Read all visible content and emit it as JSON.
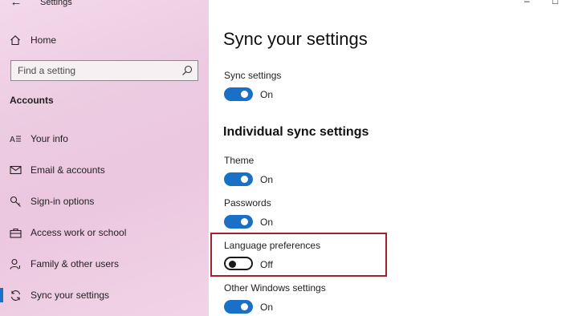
{
  "window": {
    "title": "Settings",
    "back": "←",
    "minimize": "–",
    "maximize": "□"
  },
  "sidebar": {
    "home": "Home",
    "search_placeholder": "Find a setting",
    "section": "Accounts",
    "items": [
      {
        "label": "Your info"
      },
      {
        "label": "Email & accounts"
      },
      {
        "label": "Sign-in options"
      },
      {
        "label": "Access work or school"
      },
      {
        "label": "Family & other users"
      },
      {
        "label": "Sync your settings"
      }
    ]
  },
  "main": {
    "title": "Sync your settings",
    "sync": {
      "label": "Sync settings",
      "state": "On"
    },
    "subheading": "Individual sync settings",
    "settings": [
      {
        "label": "Theme",
        "state": "On"
      },
      {
        "label": "Passwords",
        "state": "On"
      },
      {
        "label": "Language preferences",
        "state": "Off"
      },
      {
        "label": "Other Windows settings",
        "state": "On"
      }
    ]
  },
  "colors": {
    "accent": "#1a6fc6",
    "highlight": "#a3222c",
    "sidebar": "#ecc7e0"
  }
}
